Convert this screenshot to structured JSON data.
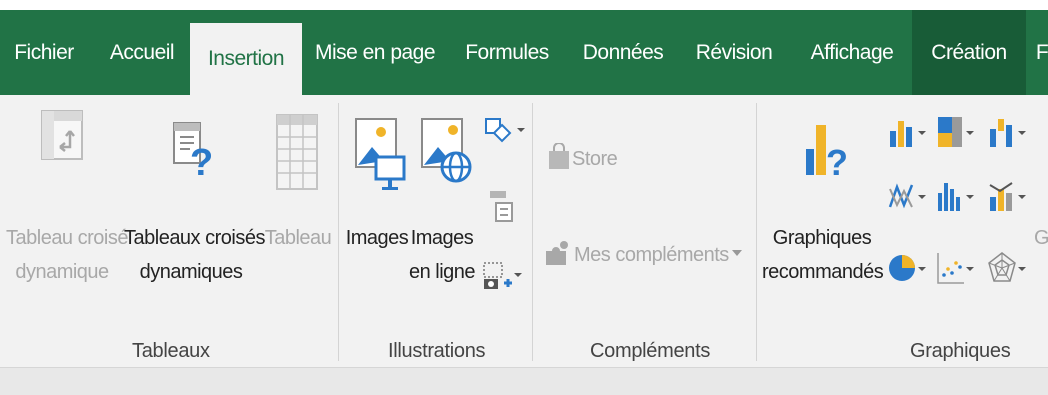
{
  "tabs": {
    "fichier": "Fichier",
    "accueil": "Accueil",
    "insertion": "Insertion",
    "mise_en_page": "Mise en page",
    "formules": "Formules",
    "donnees": "Données",
    "revision": "Révision",
    "affichage": "Affichage",
    "creation": "Création",
    "cut": "F"
  },
  "tableaux": {
    "croise_line1": "Tableau croisé",
    "croise_line2": "dynamique",
    "croises_line1": "Tableaux croisés",
    "croises_line2": "dynamiques",
    "tableau": "Tableau",
    "group": "Tableaux"
  },
  "illustrations": {
    "images": "Images",
    "images_ligne_line1": "Images",
    "images_ligne_line2": "en ligne",
    "group": "Illustrations"
  },
  "complements": {
    "store": "Store",
    "mes": "Mes compléments",
    "group": "Compléments"
  },
  "graphiques": {
    "recommandes_line1": "Graphiques",
    "recommandes_line2": "recommandés",
    "group": "Graphiques",
    "cut": "G"
  },
  "colors": {
    "ribbon_green": "#217346",
    "creation_green": "#185c37",
    "ribbon_bg": "#f2f2f2"
  }
}
